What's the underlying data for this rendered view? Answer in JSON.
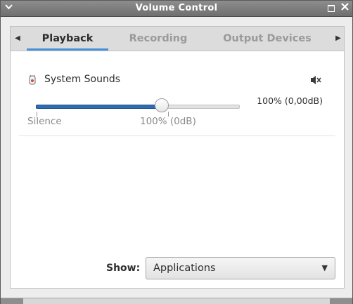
{
  "window": {
    "title": "Volume Control"
  },
  "tabs": [
    {
      "label": "Playback",
      "active": true
    },
    {
      "label": "Recording",
      "active": false
    },
    {
      "label": "Output Devices",
      "active": false
    }
  ],
  "stream": {
    "name": "System Sounds",
    "volume_readout": "100% (0,00dB)",
    "volume_fraction": 0.62,
    "slider_labels": {
      "min": "Silence",
      "mid": "100% (0dB)"
    }
  },
  "footer": {
    "show_label": "Show:",
    "show_value": "Applications"
  },
  "icons": {
    "window_menu": "chevron-down-icon",
    "maximize": "maximize-icon",
    "close": "close-icon",
    "tab_left": "caret-left-icon",
    "tab_right": "caret-right-icon",
    "stream": "bell-icon",
    "mute": "speaker-mute-icon",
    "dropdown": "caret-down-icon"
  },
  "colors": {
    "accent": "#4a90d9",
    "slider_fill": "#2f6db5"
  }
}
